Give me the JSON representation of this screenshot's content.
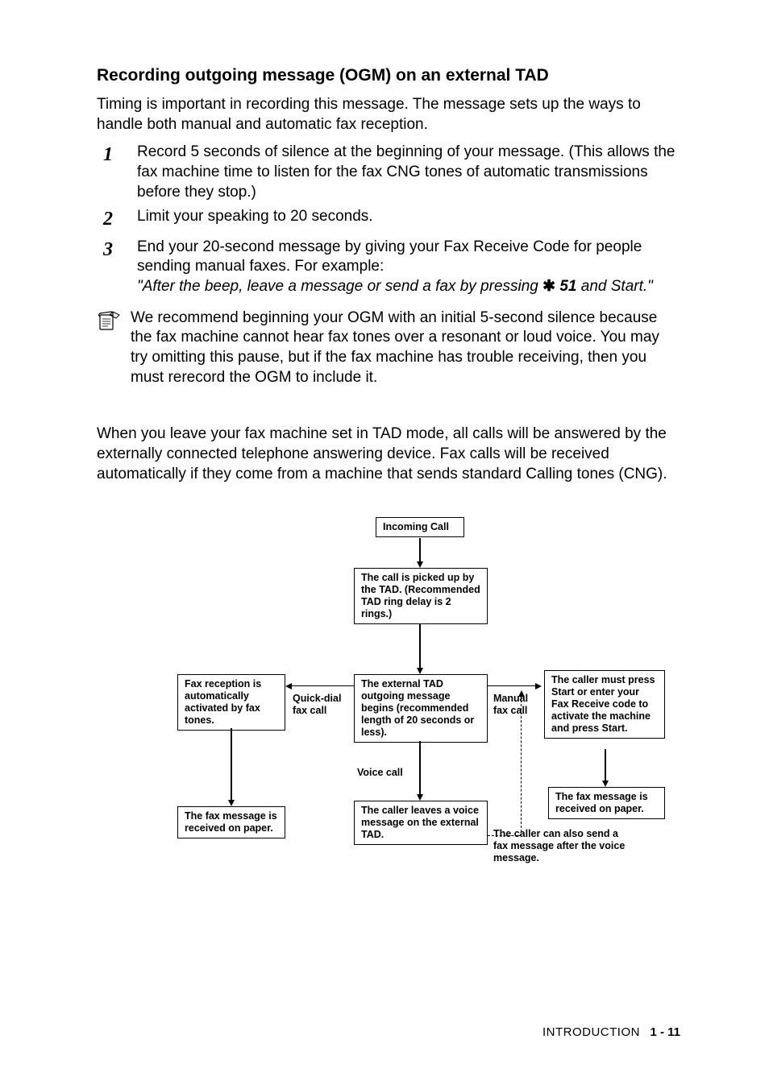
{
  "heading": "Recording outgoing message (OGM) on an external TAD",
  "intro": "Timing is important in recording this message. The message sets up the ways to handle both manual and automatic fax reception.",
  "steps": [
    {
      "num": "1",
      "text": "Record 5 seconds of silence at the beginning of your message. (This allows the fax machine time to listen for the fax CNG tones of automatic transmissions before they stop.)"
    },
    {
      "num": "2",
      "text": "Limit your speaking to 20 seconds."
    },
    {
      "num": "3",
      "text": "End your 20-second message by giving your Fax Receive Code for people sending manual faxes. For example:",
      "example_pre": "\"After the beep, leave a message or send a fax by pressing ",
      "example_code": "51",
      "example_post": " and Start.\""
    }
  ],
  "note": "We recommend beginning your OGM with an initial 5-second silence because the fax machine cannot hear fax tones over a resonant or loud voice. You may try omitting this pause, but if the fax machine has trouble receiving, then you must rerecord the OGM to include it.",
  "tad_para": "When you leave your fax machine set in TAD mode, all calls will be answered by the externally connected telephone answering device. Fax calls will be received automatically if they come from a machine that sends standard Calling tones (CNG).",
  "flow": {
    "incoming": "Incoming Call",
    "picked_up": "The call is picked up by the TAD. (Recommended TAD ring delay is 2 rings.)",
    "ogm": "The external TAD outgoing message begins (recommended length of 20 seconds or less).",
    "quick_dial": "Quick-dial fax call",
    "manual": "Manual fax call",
    "voice_lbl": "Voice call",
    "fax_auto": "Fax reception is automatically activated by fax tones.",
    "caller_press": "The caller must press Start or enter your Fax Receive code to activate the machine and press Start.",
    "fax_msg_left": "The fax message is received on paper.",
    "fax_msg_right": "The fax message is received on paper.",
    "voice_msg": "The caller leaves a voice message on the external TAD.",
    "after_voice": "The caller can also send a fax message after the voice message."
  },
  "footer": {
    "section": "INTRODUCTION",
    "page": "1 - 11"
  }
}
